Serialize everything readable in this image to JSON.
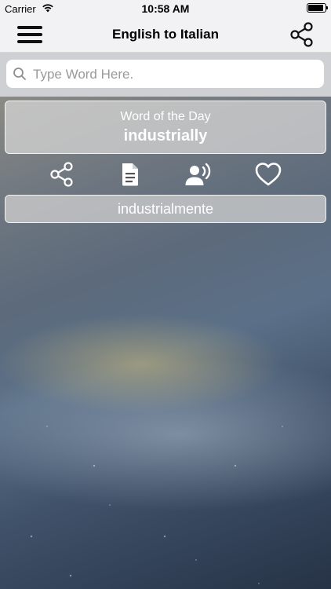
{
  "status_bar": {
    "carrier": "Carrier",
    "time": "10:58 AM"
  },
  "nav": {
    "title": "English to Italian",
    "menu_icon": "hamburger-menu-icon",
    "share_icon": "share-icon"
  },
  "search": {
    "placeholder": "Type Word Here.",
    "value": ""
  },
  "word_of_day": {
    "heading": "Word of the Day",
    "word": "industrially"
  },
  "actions": [
    {
      "name": "share",
      "icon": "share-icon"
    },
    {
      "name": "document",
      "icon": "document-icon"
    },
    {
      "name": "speak",
      "icon": "speaker-voice-icon"
    },
    {
      "name": "favorite",
      "icon": "heart-icon"
    }
  ],
  "translation": {
    "text": "industrialmente"
  },
  "colors": {
    "nav_background": "#f2f2f4",
    "search_background": "#cfd0d3",
    "card_text": "#ffffff"
  }
}
